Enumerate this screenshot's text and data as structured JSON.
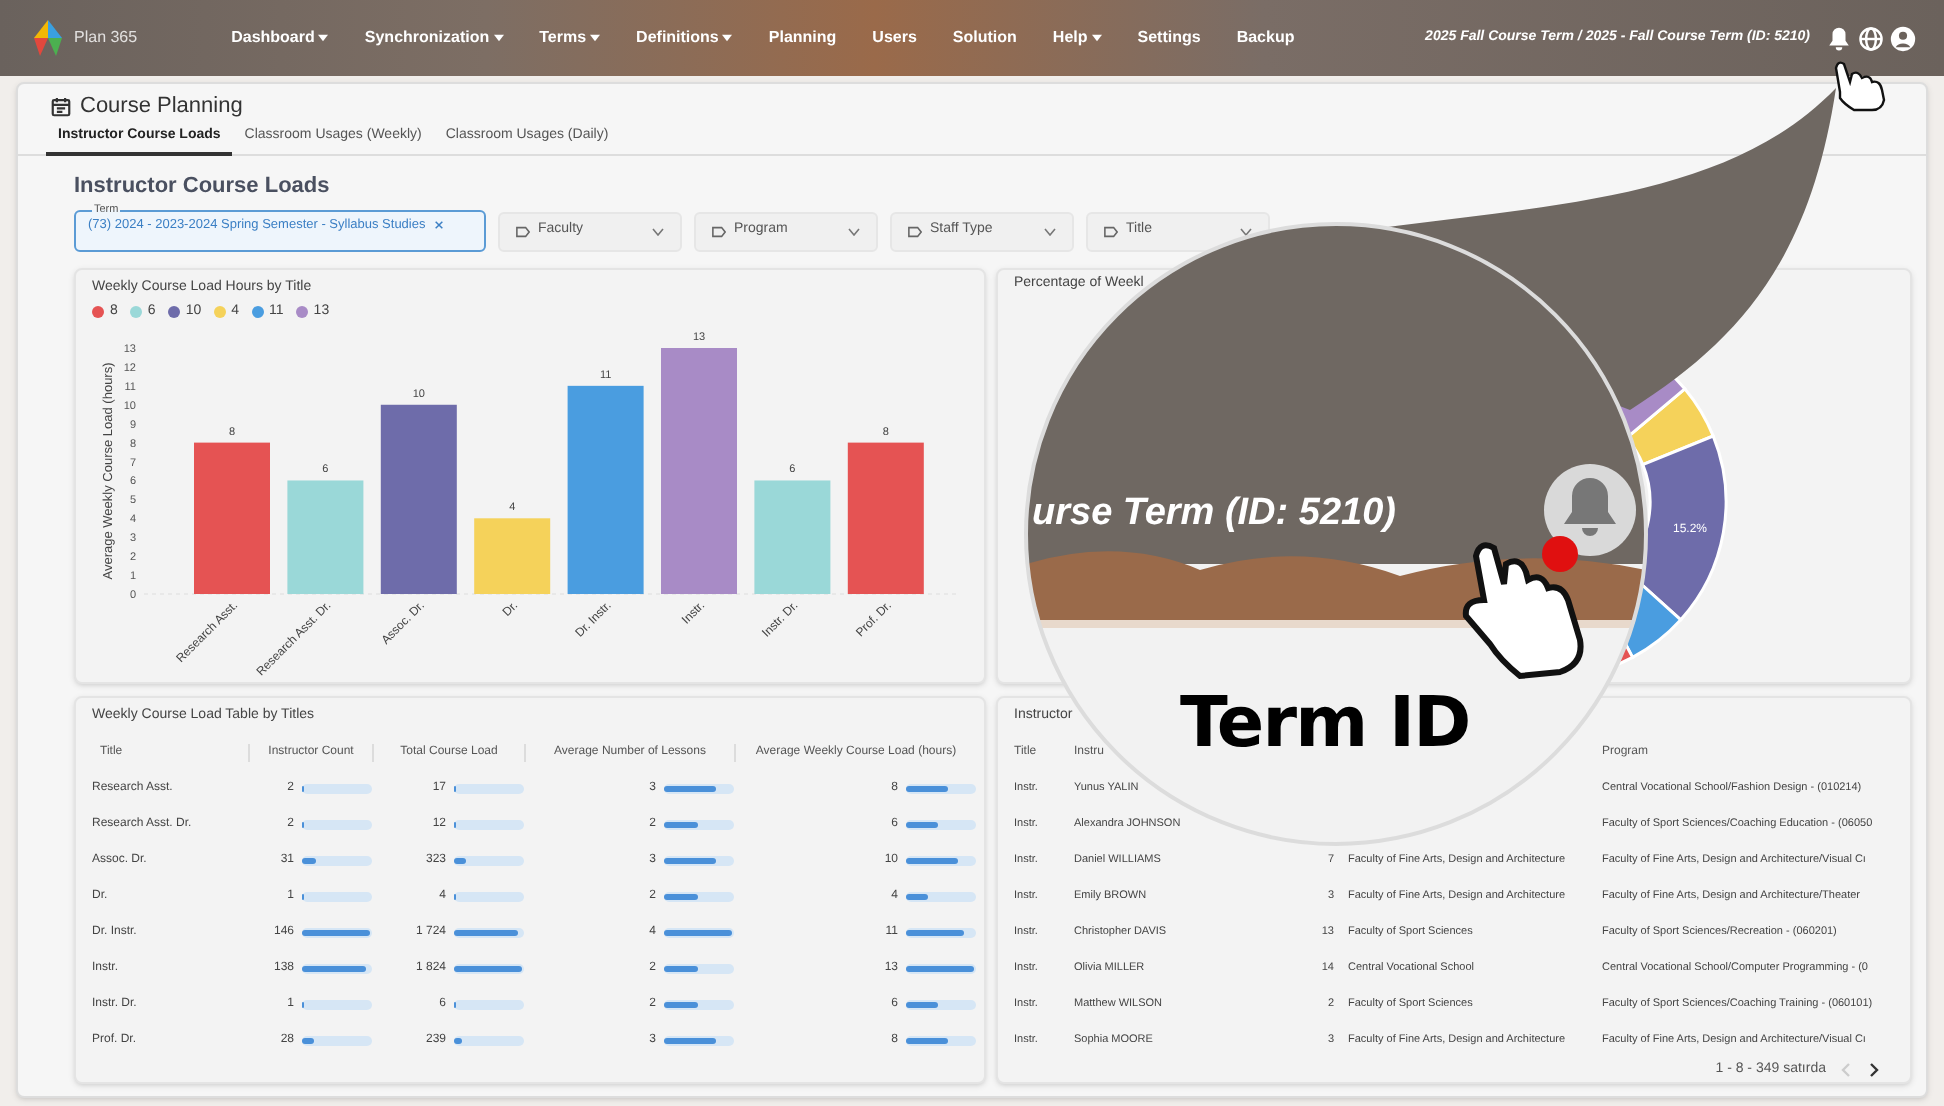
{
  "app": {
    "name": "Plan 365"
  },
  "nav": [
    {
      "label": "Dashboard",
      "dropdown": true
    },
    {
      "label": "Synchronization",
      "dropdown": true
    },
    {
      "label": "Terms",
      "dropdown": true
    },
    {
      "label": "Definitions",
      "dropdown": true
    },
    {
      "label": "Planning",
      "dropdown": false
    },
    {
      "label": "Users",
      "dropdown": false
    },
    {
      "label": "Solution",
      "dropdown": false
    },
    {
      "label": "Help",
      "dropdown": true
    },
    {
      "label": "Settings",
      "dropdown": false
    },
    {
      "label": "Backup",
      "dropdown": false
    }
  ],
  "term_display": "2025 Fall Course Term / 2025 - Fall Course Term (ID: 5210)",
  "page": {
    "title": "Course Planning",
    "tabs": [
      {
        "label": "Instructor Course Loads",
        "selected": true
      },
      {
        "label": "Classroom Usages (Weekly)",
        "selected": false
      },
      {
        "label": "Classroom Usages (Daily)",
        "selected": false
      }
    ]
  },
  "section_title": "Instructor Course Loads",
  "filters": [
    {
      "kind": "chip",
      "label": "Term",
      "value": "(73) 2024 - 2023-2024 Spring Semester - Syllabus Studies"
    },
    {
      "kind": "select",
      "placeholder": "Faculty"
    },
    {
      "kind": "select",
      "placeholder": "Program"
    },
    {
      "kind": "select",
      "placeholder": "Staff Type"
    },
    {
      "kind": "select",
      "placeholder": "Title"
    }
  ],
  "bar_panel": {
    "title": "Weekly Course Load Hours by Title",
    "chart_data": {
      "type": "bar",
      "ylabel": "Average Weekly Course Load (hours)",
      "categories": [
        "Research Asst.",
        "Research Asst. Dr.",
        "Assoc. Dr.",
        "Dr.",
        "Dr. Instr.",
        "Instr.",
        "Instr. Dr.",
        "Prof. Dr."
      ],
      "stacked": true,
      "data_labels": true,
      "yticks": [
        0,
        1,
        2,
        3,
        4,
        5,
        6,
        7,
        8,
        9,
        10,
        11,
        12,
        13
      ],
      "ylim": [
        0,
        13
      ],
      "series": [
        {
          "name": "8",
          "color": "#e55353",
          "values": [
            8,
            null,
            null,
            null,
            null,
            null,
            null,
            8
          ]
        },
        {
          "name": "6",
          "color": "#9ad8d8",
          "values": [
            null,
            6,
            null,
            null,
            null,
            null,
            6,
            null
          ]
        },
        {
          "name": "10",
          "color": "#6e6caa",
          "values": [
            null,
            null,
            10,
            null,
            null,
            null,
            null,
            null
          ]
        },
        {
          "name": "4",
          "color": "#f5d25a",
          "values": [
            null,
            null,
            null,
            4,
            null,
            null,
            null,
            null
          ]
        },
        {
          "name": "11",
          "color": "#4a9de0",
          "values": [
            null,
            null,
            null,
            null,
            11,
            null,
            null,
            null
          ]
        },
        {
          "name": "13",
          "color": "#a88bc6",
          "values": [
            null,
            null,
            null,
            null,
            null,
            13,
            null,
            null
          ]
        }
      ]
    }
  },
  "pie_panel": {
    "title": "Percentage of Weekl",
    "slice_label": "15.2%"
  },
  "title_table": {
    "title": "Weekly Course Load Table by Titles",
    "columns": [
      "Title",
      "Instructor Count",
      "Total Course Load",
      "Average Number of Lessons",
      "Average Weekly Course Load (hours)"
    ],
    "rows": [
      {
        "cells": [
          {
            "text": "Research Asst."
          },
          {
            "text": "2",
            "level": 0.01
          },
          {
            "text": "17",
            "level": 0.01
          },
          {
            "text": "3",
            "level": 0.75
          },
          {
            "text": "8",
            "level": 0.62
          }
        ]
      },
      {
        "cells": [
          {
            "text": "Research Asst. Dr."
          },
          {
            "text": "2",
            "level": 0.01
          },
          {
            "text": "12",
            "level": 0.01
          },
          {
            "text": "2",
            "level": 0.5
          },
          {
            "text": "6",
            "level": 0.46
          }
        ]
      },
      {
        "cells": [
          {
            "text": "Assoc. Dr."
          },
          {
            "text": "31",
            "level": 0.21
          },
          {
            "text": "323",
            "level": 0.18
          },
          {
            "text": "3",
            "level": 0.75
          },
          {
            "text": "10",
            "level": 0.77
          }
        ]
      },
      {
        "cells": [
          {
            "text": "Dr."
          },
          {
            "text": "1",
            "level": 0.01
          },
          {
            "text": "4",
            "level": 0.01
          },
          {
            "text": "2",
            "level": 0.5
          },
          {
            "text": "4",
            "level": 0.31
          }
        ]
      },
      {
        "cells": [
          {
            "text": "Dr. Instr."
          },
          {
            "text": "146",
            "level": 1
          },
          {
            "text": "1 724",
            "level": 0.95
          },
          {
            "text": "4",
            "level": 1
          },
          {
            "text": "11",
            "level": 0.85
          }
        ]
      },
      {
        "cells": [
          {
            "text": "Instr."
          },
          {
            "text": "138",
            "level": 0.95
          },
          {
            "text": "1 824",
            "level": 1
          },
          {
            "text": "2",
            "level": 0.5
          },
          {
            "text": "13",
            "level": 1
          }
        ]
      },
      {
        "cells": [
          {
            "text": "Instr. Dr."
          },
          {
            "text": "1",
            "level": 0.01
          },
          {
            "text": "6",
            "level": 0.01
          },
          {
            "text": "2",
            "level": 0.5
          },
          {
            "text": "6",
            "level": 0.46
          }
        ]
      },
      {
        "cells": [
          {
            "text": "Prof. Dr."
          },
          {
            "text": "28",
            "level": 0.19
          },
          {
            "text": "239",
            "level": 0.13
          },
          {
            "text": "3",
            "level": 0.75
          },
          {
            "text": "8",
            "level": 0.62
          }
        ]
      }
    ]
  },
  "instructor_table": {
    "title": "Instructor",
    "columns": {
      "title": "Title",
      "instructor": "Instru",
      "program": "Program"
    },
    "rows": [
      {
        "title": "Instr.",
        "instructor": "Yunus YALIN",
        "program": "Central Vocational School/Fashion Design - (010214)"
      },
      {
        "title": "Instr.",
        "instructor": "Alexandra JOHNSON",
        "program": "Faculty of Sport Sciences/Coaching Education - (06050"
      },
      {
        "title": "Instr.",
        "instructor": "Daniel WILLIAMS",
        "count": "7",
        "faculty": "Faculty of Fine Arts, Design and Architecture",
        "program": "Faculty of Fine Arts, Design and Architecture/Visual Cı"
      },
      {
        "title": "Instr.",
        "instructor": "Emily BROWN",
        "count": "3",
        "faculty": "Faculty of Fine Arts, Design and Architecture",
        "program": "Faculty of Fine Arts, Design and Architecture/Theater"
      },
      {
        "title": "Instr.",
        "instructor": "Christopher DAVIS",
        "count": "13",
        "faculty": "Faculty of Sport Sciences",
        "program": "Faculty of Sport Sciences/Recreation - (060201)"
      },
      {
        "title": "Instr.",
        "instructor": "Olivia MILLER",
        "count": "14",
        "faculty": "Central Vocational School",
        "program": "Central Vocational School/Computer Programming - (0"
      },
      {
        "title": "Instr.",
        "instructor": "Matthew WILSON",
        "count": "2",
        "faculty": "Faculty of Sport Sciences",
        "program": "Faculty of Sport Sciences/Coaching Training - (060101)"
      },
      {
        "title": "Instr.",
        "instructor": "Sophia MOORE",
        "count": "3",
        "faculty": "Faculty of Fine Arts, Design and Architecture",
        "program": "Faculty of Fine Arts, Design and Architecture/Visual Cı"
      }
    ],
    "pagination": {
      "range": "1 - 8 - 349 satırda",
      "prev_disabled": true
    }
  },
  "callout": {
    "magnified_text": "urse Term (ID: 5210)",
    "caption": "Term ID"
  }
}
